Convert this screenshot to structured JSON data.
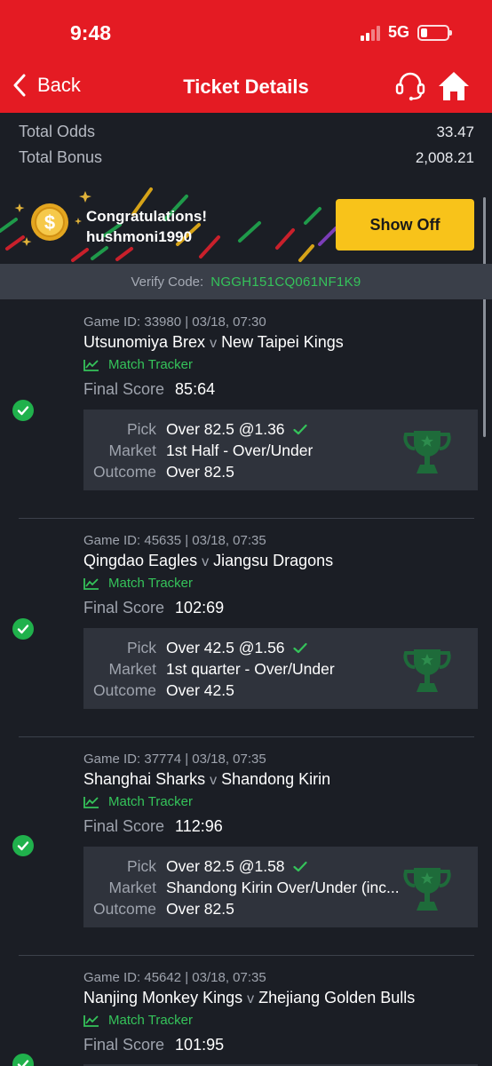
{
  "status_bar": {
    "time": "9:48",
    "network": "5G"
  },
  "header": {
    "back_label": "Back",
    "title": "Ticket Details"
  },
  "icons": {
    "back": "chevron-left-icon",
    "support": "headset-icon",
    "home": "home-icon",
    "coin": "coin-icon",
    "check": "check-circle-icon",
    "tracker": "chart-line-icon",
    "trophy": "trophy-icon"
  },
  "colors": {
    "header": "#e41b23",
    "accent_green": "#35c35a",
    "show_off": "#f8c31a",
    "background": "#1b1e25"
  },
  "totals": [
    {
      "label": "Total Odds",
      "value": "33.47"
    },
    {
      "label": "Total Bonus",
      "value": "2,008.21"
    }
  ],
  "banner": {
    "congrats": "Congratulations!",
    "username": "hushmoni1990",
    "button": "Show Off"
  },
  "verify": {
    "label": "Verify Code:",
    "code": "NGGH151CQ061NF1K9"
  },
  "labels": {
    "tracker": "Match Tracker",
    "final_score": "Final Score",
    "pick": "Pick",
    "market": "Market",
    "outcome": "Outcome",
    "vs": "v"
  },
  "bets": [
    {
      "game_id": "Game ID: 33980 | 03/18, 07:30",
      "home": "Utsunomiya Brex",
      "away": "New Taipei Kings",
      "score": "85:64",
      "pick": "Over 82.5 @1.36",
      "market": "1st Half - Over/Under",
      "outcome": "Over 82.5"
    },
    {
      "game_id": "Game ID: 45635 | 03/18, 07:35",
      "home": "Qingdao Eagles",
      "away": "Jiangsu Dragons",
      "score": "102:69",
      "pick": "Over 42.5 @1.56",
      "market": "1st quarter - Over/Under",
      "outcome": "Over 42.5"
    },
    {
      "game_id": "Game ID: 37774 | 03/18, 07:35",
      "home": "Shanghai Sharks",
      "away": "Shandong Kirin",
      "score": "112:96",
      "pick": "Over 82.5 @1.58",
      "market": "Shandong Kirin Over/Under (inc...",
      "outcome": "Over 82.5"
    },
    {
      "game_id": "Game ID: 45642 | 03/18, 07:35",
      "home": "Nanjing Monkey Kings",
      "away": "Zhejiang Golden Bulls",
      "score": "101:95"
    }
  ]
}
